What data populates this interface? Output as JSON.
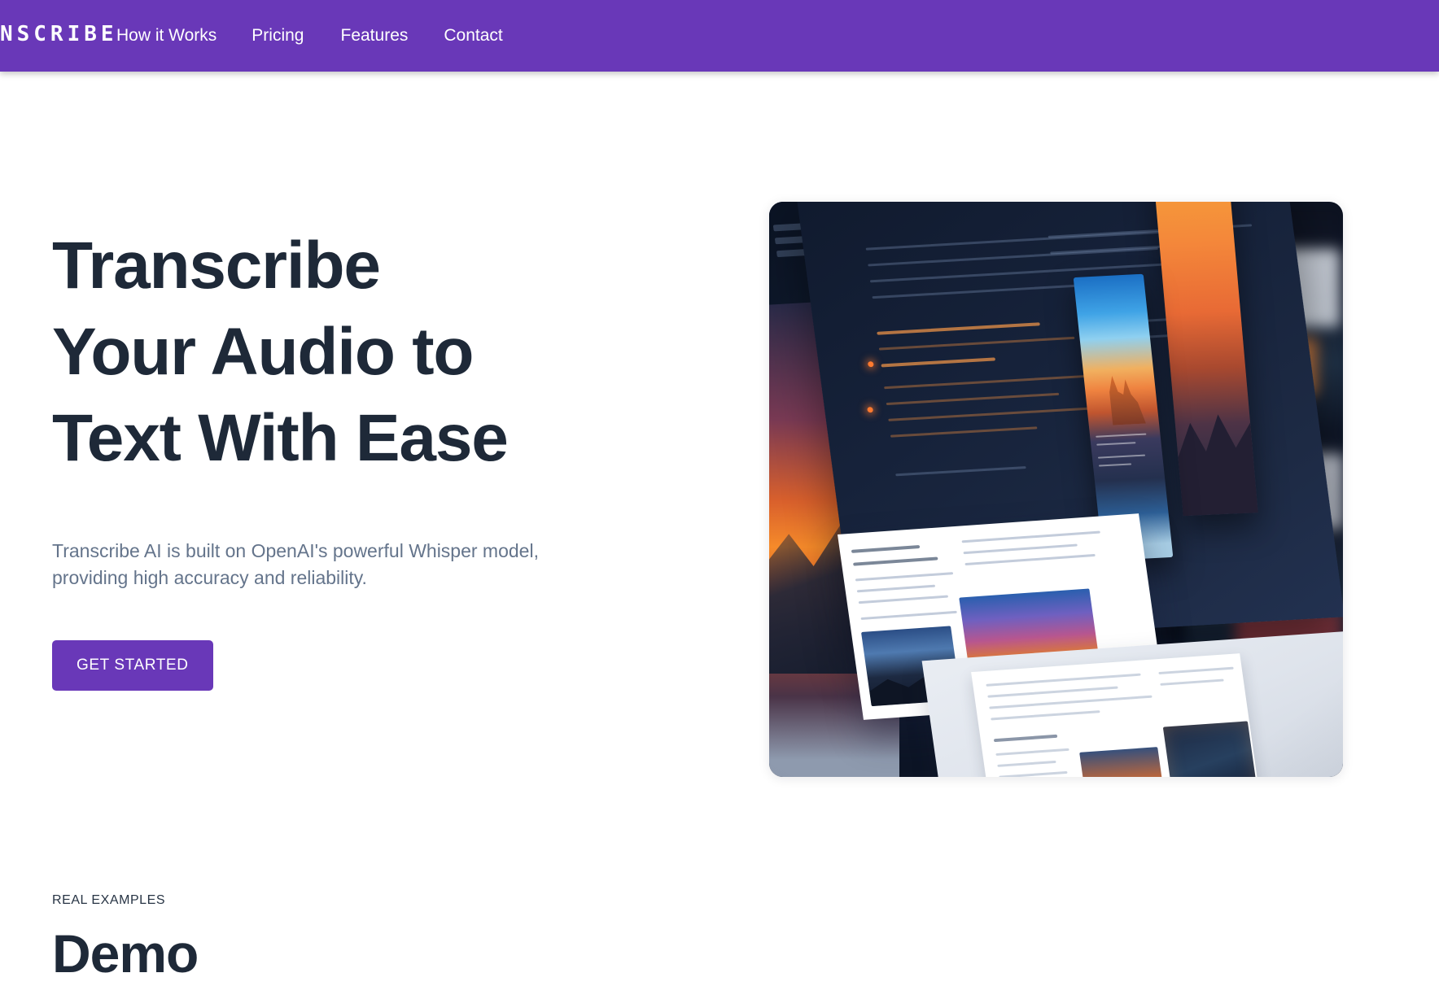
{
  "navbar": {
    "brand": "TRANSCRIBE",
    "background_color": "#6938b8",
    "links": [
      {
        "label": "How it Works"
      },
      {
        "label": "Pricing"
      },
      {
        "label": "Features"
      },
      {
        "label": "Contact"
      }
    ]
  },
  "hero": {
    "title_line1": "Transcribe",
    "title_line2": "Your Audio to",
    "title_line3": "Text With Ease",
    "title_color": "#1e2938",
    "subtitle": "Transcribe AI is built on OpenAI's powerful Whisper model, providing high accuracy and reliability.",
    "subtitle_color": "#64748b",
    "cta_label": "GET STARTED",
    "cta_color": "#6938b8",
    "image_alt": "Illustration of floating website screens showing sunset landscape artwork above a laptop"
  },
  "demo": {
    "eyebrow": "REAL EXAMPLES",
    "title": "Demo"
  },
  "theme": {
    "accent": "#6938b8",
    "page_background": "#ffffff",
    "heading": "#1e2938",
    "muted_text": "#64748b"
  }
}
